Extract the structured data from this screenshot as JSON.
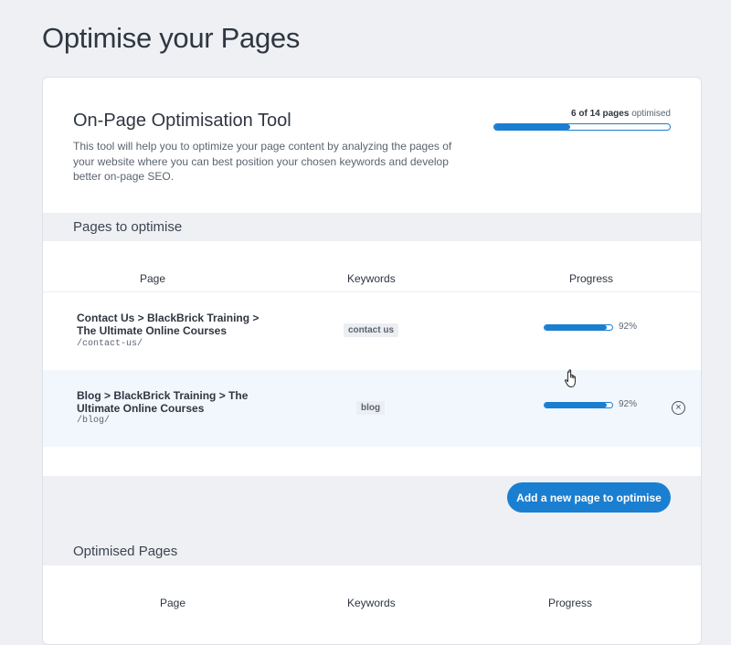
{
  "page": {
    "title": "Optimise your Pages"
  },
  "tool": {
    "title": "On-Page Optimisation Tool",
    "description": "This tool will help you to optimize your page content by analyzing the pages of your website where you can best position your chosen keywords and develop better on-page SEO.",
    "overall_count": "6 of 14 pages",
    "overall_suffix": "optimised",
    "overall_fraction": 0.43
  },
  "to_optimise": {
    "header": "Pages to optimise",
    "columns": {
      "page": "Page",
      "keywords": "Keywords",
      "progress": "Progress"
    },
    "rows": [
      {
        "page": "Contact Us > BlackBrick Training > The Ultimate Online Courses",
        "path": "/contact-us/",
        "keyword": "contact us",
        "progress_pct": "92%",
        "progress": 0.92
      },
      {
        "page": "Blog > BlackBrick Training > The Ultimate Online Courses",
        "path": "/blog/",
        "keyword": "blog",
        "progress_pct": "92%",
        "progress": 0.92
      }
    ],
    "add_button": "Add a new page to optimise"
  },
  "optimised": {
    "header": "Optimised Pages",
    "columns": {
      "page": "Page",
      "keywords": "Keywords",
      "progress": "Progress"
    }
  },
  "colors": {
    "accent": "#1a7fd0",
    "background": "#eef0f4",
    "row_highlight": "#f1f7fd"
  },
  "icons": {
    "remove": "close-circle-icon",
    "cursor": "hand-pointer-icon"
  }
}
